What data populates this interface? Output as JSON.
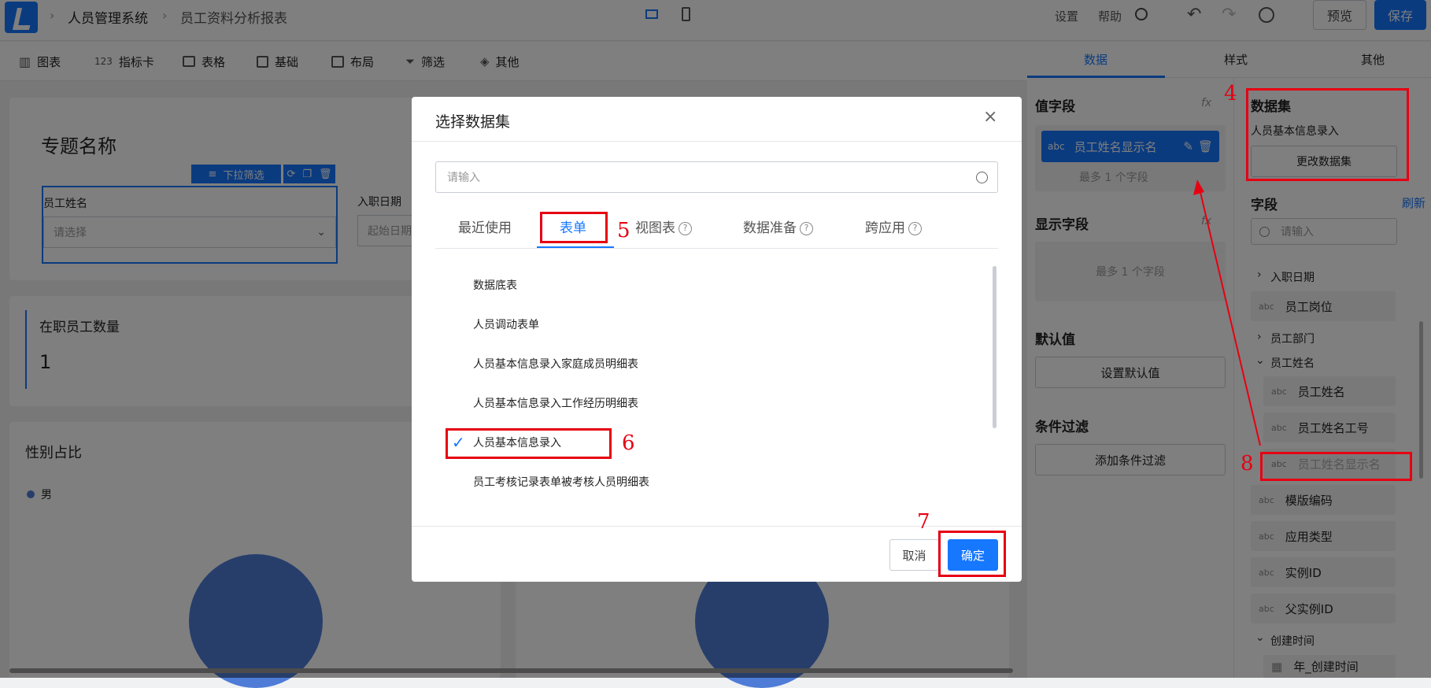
{
  "topbar": {
    "breadcrumb": [
      "人员管理系统",
      "员工资料分析报表"
    ],
    "settings": "设置",
    "help": "帮助",
    "preview": "预览",
    "save": "保存"
  },
  "toolbar": {
    "items": [
      "图表",
      "指标卡",
      "表格",
      "基础",
      "布局",
      "筛选",
      "其他"
    ],
    "metric_icon_text": "123"
  },
  "canvas": {
    "title": "专题名称",
    "filter_tag": "下拉筛选",
    "employee_name_label": "员工姓名",
    "employee_name_placeholder": "请选择",
    "hire_date_label": "入职日期",
    "hire_date_placeholder": "起始日期",
    "active_count_label": "在职员工数量",
    "active_count_value": "1",
    "gender_title": "性别占比",
    "legend_male": "男"
  },
  "right_panel": {
    "tabs": [
      "数据",
      "样式",
      "其他"
    ],
    "value_field_title": "值字段",
    "value_field_chip": "员工姓名显示名",
    "value_field_chip_tag": "abc",
    "max_one": "最多 1 个字段",
    "display_field_title": "显示字段",
    "default_title": "默认值",
    "set_default": "设置默认值",
    "filter_title": "条件过滤",
    "add_filter": "添加条件过滤",
    "fx": "fx",
    "dataset_title": "数据集",
    "dataset_name": "人员基本信息录入",
    "change_dataset": "更改数据集",
    "fields_title": "字段",
    "refresh": "刷新",
    "field_search_placeholder": "请输入",
    "fields": [
      {
        "tag": "",
        "label": "入职日期",
        "kind": "group-collapsed"
      },
      {
        "tag": "abc",
        "label": "员工岗位",
        "kind": "field"
      },
      {
        "tag": "",
        "label": "员工部门",
        "kind": "group-collapsed"
      },
      {
        "tag": "",
        "label": "员工姓名",
        "kind": "group-expanded"
      },
      {
        "tag": "abc",
        "label": "员工姓名",
        "kind": "sub"
      },
      {
        "tag": "abc",
        "label": "员工姓名工号",
        "kind": "sub"
      },
      {
        "tag": "abc",
        "label": "员工姓名显示名",
        "kind": "sub-disabled"
      },
      {
        "tag": "abc",
        "label": "模版编码",
        "kind": "field"
      },
      {
        "tag": "abc",
        "label": "应用类型",
        "kind": "field"
      },
      {
        "tag": "abc",
        "label": "实例ID",
        "kind": "field"
      },
      {
        "tag": "abc",
        "label": "父实例ID",
        "kind": "field"
      },
      {
        "tag": "",
        "label": "创建时间",
        "kind": "group-expanded"
      },
      {
        "tag": "",
        "label": "年_创建时间",
        "kind": "sub-date"
      }
    ]
  },
  "modal": {
    "title": "选择数据集",
    "search_placeholder": "请输入",
    "tabs": [
      "最近使用",
      "表单",
      "视图表",
      "数据准备",
      "跨应用"
    ],
    "help_glyph": "?",
    "items": [
      "数据底表",
      "人员调动表单",
      "人员基本信息录入家庭成员明细表",
      "人员基本信息录入工作经历明细表",
      "人员基本信息录入",
      "员工考核记录表单被考核人员明细表"
    ],
    "cancel": "取消",
    "confirm": "确定"
  },
  "annotations": [
    "4",
    "5",
    "6",
    "7",
    "8"
  ],
  "colors": {
    "brand": "#1677ff",
    "chip": "#1677ff",
    "annotation": "#e60012",
    "pie": "#4e7cd7"
  }
}
